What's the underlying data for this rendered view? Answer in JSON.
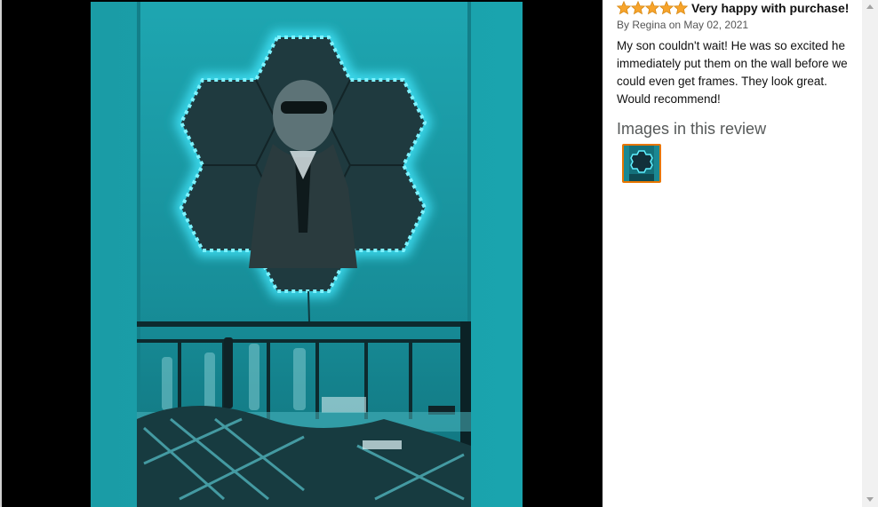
{
  "review": {
    "rating": 5,
    "rating_max": 5,
    "title": "Very happy with purchase!",
    "byline": "By Regina on May 02, 2021",
    "body": "My son couldn't wait! He was so excited he immediately put them on the wall before we could even get frames. They look great. Would recommend!",
    "images_heading": "Images in this review"
  },
  "icons": {
    "star": "star-icon",
    "scroll_up": "scroll-up-arrow-icon",
    "scroll_down": "scroll-down-arrow-icon"
  },
  "colors": {
    "star_fill": "#f7a42c",
    "thumb_border": "#e77600",
    "led_glow": "#3fe6ff",
    "wall_teal": "#1b9aa6"
  }
}
